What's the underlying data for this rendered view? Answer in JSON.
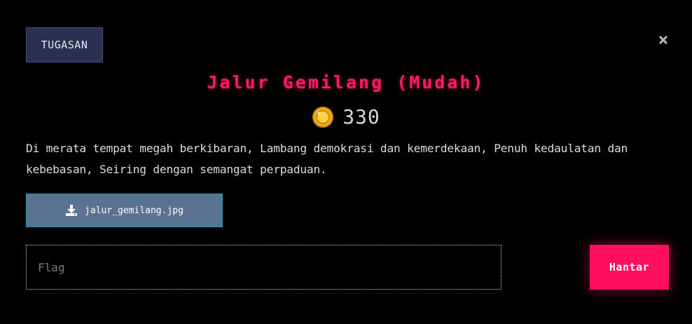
{
  "modal": {
    "category": "TUGASAN",
    "close_icon": "close-icon",
    "title": "Jalur Gemilang (Mudah)",
    "points": "330",
    "points_icon": "coin-icon",
    "description": "Di merata tempat megah berkibaran, Lambang demokrasi dan kemerdekaan, Penuh kedaulatan dan kebebasan, Seiring dengan semangat perpaduan.",
    "attachment": {
      "icon": "download-icon",
      "filename": "jalur_gemilang.jpg"
    },
    "flag_input": {
      "placeholder": "Flag",
      "value": ""
    },
    "submit_label": "Hantar"
  },
  "colors": {
    "background": "#000000",
    "title": "#ff1a66",
    "badge_bg": "#2b2f52",
    "download_bg": "#5a7390",
    "submit_bg": "#ff0f5e",
    "coin": "#f2b01e"
  }
}
